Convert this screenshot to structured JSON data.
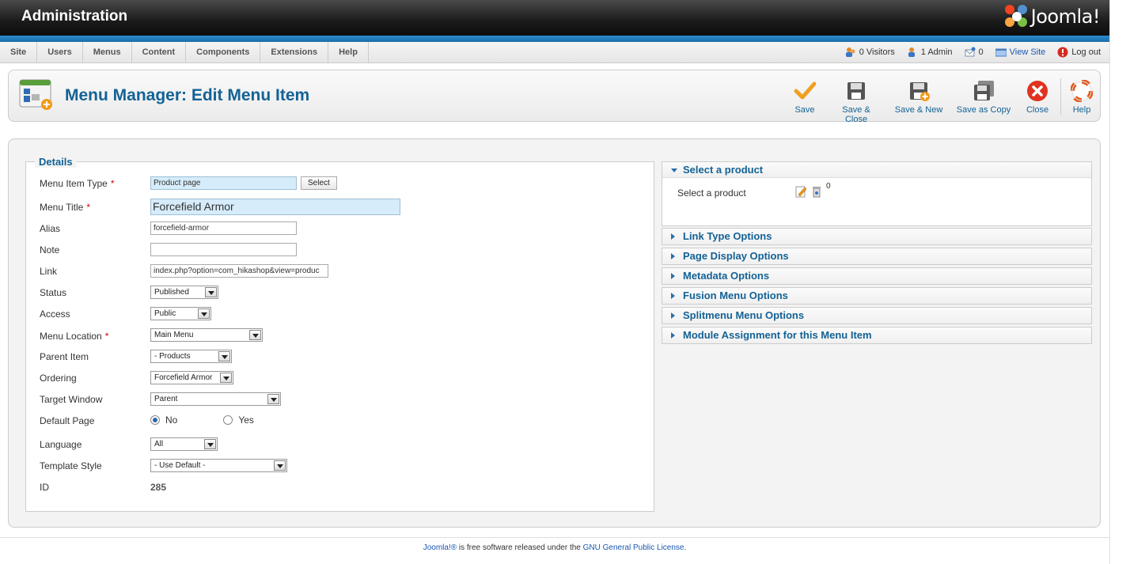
{
  "header": {
    "title": "Administration",
    "logo_text": "Joomla!"
  },
  "menu": [
    "Site",
    "Users",
    "Menus",
    "Content",
    "Components",
    "Extensions",
    "Help"
  ],
  "status": {
    "visitors": "0 Visitors",
    "admin": "1 Admin",
    "messages": "0",
    "view_site": "View Site",
    "logout": "Log out"
  },
  "toolbar": {
    "page_title": "Menu Manager: Edit Menu Item",
    "save": "Save",
    "save_close": "Save & Close",
    "save_new": "Save & New",
    "save_copy": "Save as Copy",
    "close": "Close",
    "help": "Help"
  },
  "details": {
    "legend": "Details",
    "labels": {
      "menu_item_type": "Menu Item Type",
      "menu_title": "Menu Title",
      "alias": "Alias",
      "note": "Note",
      "link": "Link",
      "status": "Status",
      "access": "Access",
      "menu_location": "Menu Location",
      "parent_item": "Parent Item",
      "ordering": "Ordering",
      "target_window": "Target Window",
      "default_page": "Default Page",
      "language": "Language",
      "template_style": "Template Style",
      "id": "ID"
    },
    "required_mark": "*",
    "values": {
      "menu_item_type": "Product page",
      "select_button": "Select",
      "menu_title": "Forcefield Armor",
      "alias": "forcefield-armor",
      "note": "",
      "link": "index.php?option=com_hikashop&view=produc",
      "status": "Published",
      "access": "Public",
      "menu_location": "Main Menu",
      "parent_item": "- Products",
      "ordering": "Forcefield Armor",
      "target_window": "Parent",
      "default_no": "No",
      "default_yes": "Yes",
      "language": "All",
      "template_style": "- Use Default -",
      "id": "285"
    }
  },
  "right_panels": {
    "select_product": {
      "title": "Select a product",
      "label": "Select a product",
      "count": "0"
    },
    "collapsed": [
      "Link Type Options",
      "Page Display Options",
      "Metadata Options",
      "Fusion Menu Options",
      "Splitmenu Menu Options",
      "Module Assignment for this Menu Item"
    ]
  },
  "footer": {
    "joomla_link": "Joomla!®",
    "middle": " is free software released under the ",
    "license_link": "GNU General Public License",
    "end": "."
  }
}
